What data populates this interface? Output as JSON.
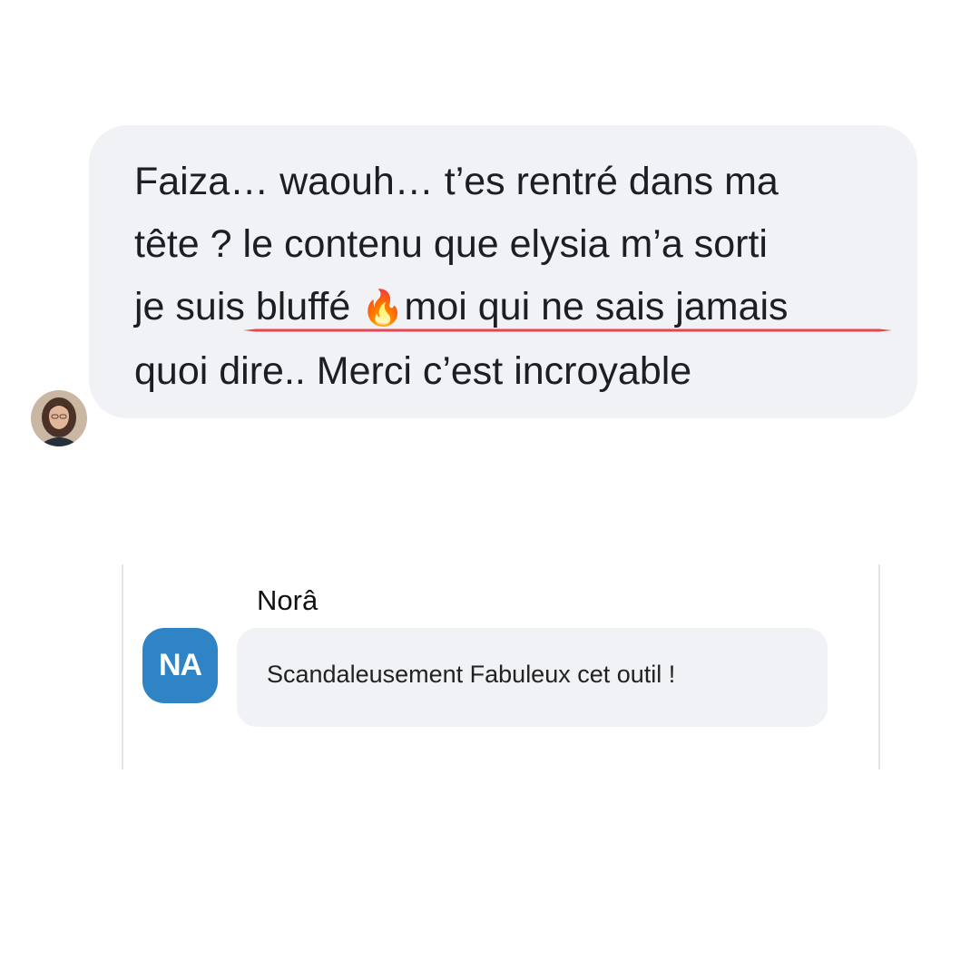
{
  "message_1": {
    "lines": [
      "Faiza… waouh… t’es rentré dans ma",
      "tête ?  le contenu que elysia m’a sorti",
      "je suis bluffé ",
      "moi qui ne sais jamais",
      "quoi dire.. Merci  c’est incroyable"
    ],
    "emoji": "🔥",
    "avatar": "profile-photo"
  },
  "message_2": {
    "sender_name": "Norâ",
    "avatar_initials": "NA",
    "avatar_color": "#2e84c4",
    "text": "Scandaleusement Fabuleux cet outil !"
  },
  "colors": {
    "bubble": "#f0f2f5",
    "underline": "#e8454f"
  }
}
